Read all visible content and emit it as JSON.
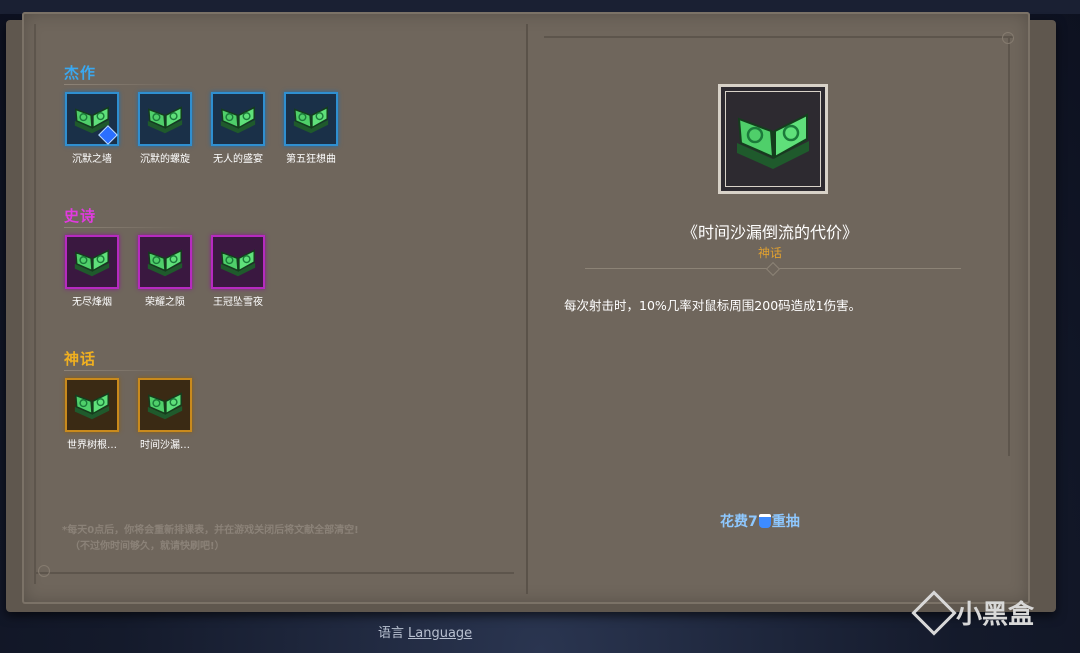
{
  "sections": [
    {
      "title": "杰作",
      "color": "#3aa8f0",
      "rarity": "blue",
      "items": [
        {
          "label": "沉默之墙",
          "badge": true
        },
        {
          "label": "沉默的螺旋",
          "badge": false
        },
        {
          "label": "无人的盛宴",
          "badge": false
        },
        {
          "label": "第五狂想曲",
          "badge": false
        }
      ]
    },
    {
      "title": "史诗",
      "color": "#e23ae0",
      "rarity": "purple",
      "items": [
        {
          "label": "无尽烽烟",
          "badge": false
        },
        {
          "label": "荣耀之陨",
          "badge": false
        },
        {
          "label": "王冠坠雪夜",
          "badge": false
        }
      ]
    },
    {
      "title": "神话",
      "color": "#f0b020",
      "rarity": "gold",
      "items": [
        {
          "label": "世界树根…",
          "badge": false
        },
        {
          "label": "时间沙漏…",
          "badge": false
        }
      ]
    }
  ],
  "notice": {
    "line1": "*每天0点后，你将会重新排课表，并在游戏关闭后将文献全部清空!",
    "line2": "（不过你时间够久，就请快刷吧!）"
  },
  "detail": {
    "title": "《时间沙漏倒流的代价》",
    "rarity": "神话",
    "description": "每次射击时，10%几率对鼠标周围200码造成1伤害。"
  },
  "reroll": {
    "prefix": "花费7",
    "suffix": "重抽"
  },
  "footer": {
    "lang_zh": "语言",
    "lang_en": "Language"
  },
  "watermark": "小黑盒"
}
